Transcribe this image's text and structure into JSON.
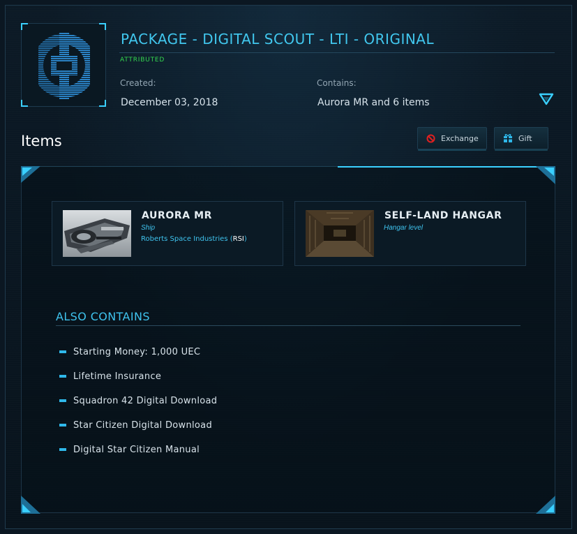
{
  "package": {
    "title": "PACKAGE - DIGITAL SCOUT - LTI - ORIGINAL",
    "status": "ATTRIBUTED",
    "created_label": "Created:",
    "created_value": "December 03, 2018",
    "contains_label": "Contains:",
    "contains_value": "Aurora MR and 6 items"
  },
  "items_section": {
    "heading": "Items",
    "exchange_label": "Exchange",
    "gift_label": "Gift"
  },
  "items": [
    {
      "name": "AURORA MR",
      "type": "Ship",
      "manufacturer": "Roberts Space Industries",
      "manufacturer_code": "RSI"
    },
    {
      "name": "SELF-LAND HANGAR",
      "type": "Hangar level"
    }
  ],
  "also_contains": {
    "heading": "ALSO CONTAINS",
    "entries": [
      "Starting Money: 1,000 UEC",
      "Lifetime Insurance",
      "Squadron 42 Digital Download",
      "Star Citizen Digital Download",
      "Digital Star Citizen Manual"
    ]
  },
  "icons": {
    "expand": "chevron-down-icon",
    "exchange": "exchange-icon",
    "gift": "gift-icon",
    "package_logo": "package-logo-icon"
  },
  "colors": {
    "accent": "#3ad0ff",
    "title": "#41c7ee",
    "status_green": "#34d94f",
    "exchange_red": "#e02020"
  }
}
